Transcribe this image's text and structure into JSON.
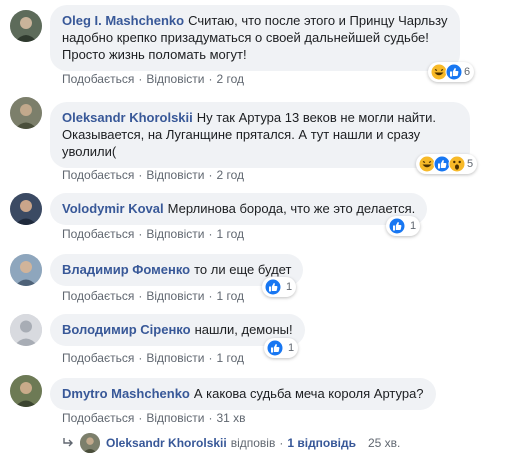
{
  "comments": [
    {
      "author": "Oleg I. Mashchenko",
      "text": "Считаю, что после этого и Принцу Чарльзу надобно крепко призадуматься о своей дальнейшей судьбе! Просто жизнь поломать могут!",
      "like": "Подобається",
      "reply": "Відповісти",
      "time": "2 год",
      "reactions": [
        "haha",
        "like"
      ],
      "reaction_count": "6"
    },
    {
      "author": "Oleksandr Khorolskii",
      "text": "Ну так Артура 13 веков не могли найти. Оказывается, на Луганщине прятался. А тут нашли и сразу уволили(",
      "like": "Подобається",
      "reply": "Відповісти",
      "time": "2 год",
      "reactions": [
        "haha",
        "like",
        "wow"
      ],
      "reaction_count": "5"
    },
    {
      "author": "Volodymir Koval",
      "text": "Мерлинова борода, что же это делается.",
      "like": "Подобається",
      "reply": "Відповісти",
      "time": "1 год",
      "reactions": [
        "like"
      ],
      "reaction_count": "1"
    },
    {
      "author": "Владимир Фоменко",
      "text": "то ли еще будет",
      "like": "Подобається",
      "reply": "Відповісти",
      "time": "1 год",
      "reactions": [
        "like"
      ],
      "reaction_count": "1"
    },
    {
      "author": "Володимир Сіренко",
      "text": "нашли, демоны!",
      "like": "Подобається",
      "reply": "Відповісти",
      "time": "1 год",
      "reactions": [
        "like"
      ],
      "reaction_count": "1"
    },
    {
      "author": "Dmytro Mashchenko",
      "text": "А какова судьба меча короля Артура?",
      "like": "Подобається",
      "reply": "Відповісти",
      "time": "31 хв",
      "reactions": [],
      "reaction_count": ""
    }
  ],
  "reply_summary": {
    "author": "Oleksandr Khorolskii",
    "action": "відповів",
    "count": "1 відповідь",
    "time": "25 хв."
  },
  "colors": {
    "bubble": "#f0f2f5",
    "author": "#385898",
    "meta": "#606770",
    "like_blue": "#1877f2",
    "haha_yellow": "#f7b928"
  }
}
